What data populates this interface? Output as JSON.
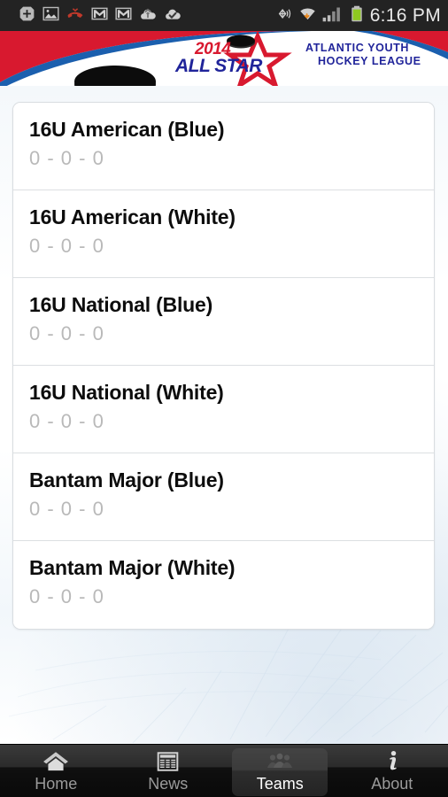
{
  "status_bar": {
    "time": "6:16 PM",
    "left_icons": [
      "add-plus-icon",
      "photo-gallery-icon",
      "missed-call-icon",
      "gmail-icon",
      "gmail-icon-2",
      "cloud-upload-icon",
      "cloud-check-icon"
    ],
    "right_icons": [
      "location-gps-icon",
      "wifi-download-icon",
      "cellular-signal-icon",
      "battery-icon"
    ],
    "background_color": "#232323",
    "text_color": "#e8e8e8",
    "battery_color": "#8ec820"
  },
  "banner": {
    "year": "2014",
    "all_star": "ALL STAR",
    "league_line1": "ATLANTIC YOUTH",
    "league_line2": "HOCKEY LEAGUE",
    "red": "#d8192f",
    "blue": "#20249a",
    "arc_blue": "#1b5fae",
    "puck_color": "#111111"
  },
  "teams": {
    "items": [
      {
        "name": "16U American (Blue)",
        "record": "0 - 0 - 0"
      },
      {
        "name": "16U American (White)",
        "record": "0 - 0 - 0"
      },
      {
        "name": "16U National (Blue)",
        "record": "0 - 0 - 0"
      },
      {
        "name": "16U National (White)",
        "record": "0 - 0 - 0"
      },
      {
        "name": "Bantam Major (Blue)",
        "record": "0 - 0 - 0"
      },
      {
        "name": "Bantam Major (White)",
        "record": "0 - 0 - 0"
      }
    ]
  },
  "tabbar": {
    "tabs": [
      {
        "label": "Home",
        "icon": "home-icon",
        "selected": false
      },
      {
        "label": "News",
        "icon": "news-icon",
        "selected": false
      },
      {
        "label": "Teams",
        "icon": "people-icon",
        "selected": true
      },
      {
        "label": "About",
        "icon": "info-icon",
        "selected": false
      }
    ],
    "selected_index": 2,
    "active_color": "#ffffff",
    "inactive_color": "#9a9a9a"
  }
}
